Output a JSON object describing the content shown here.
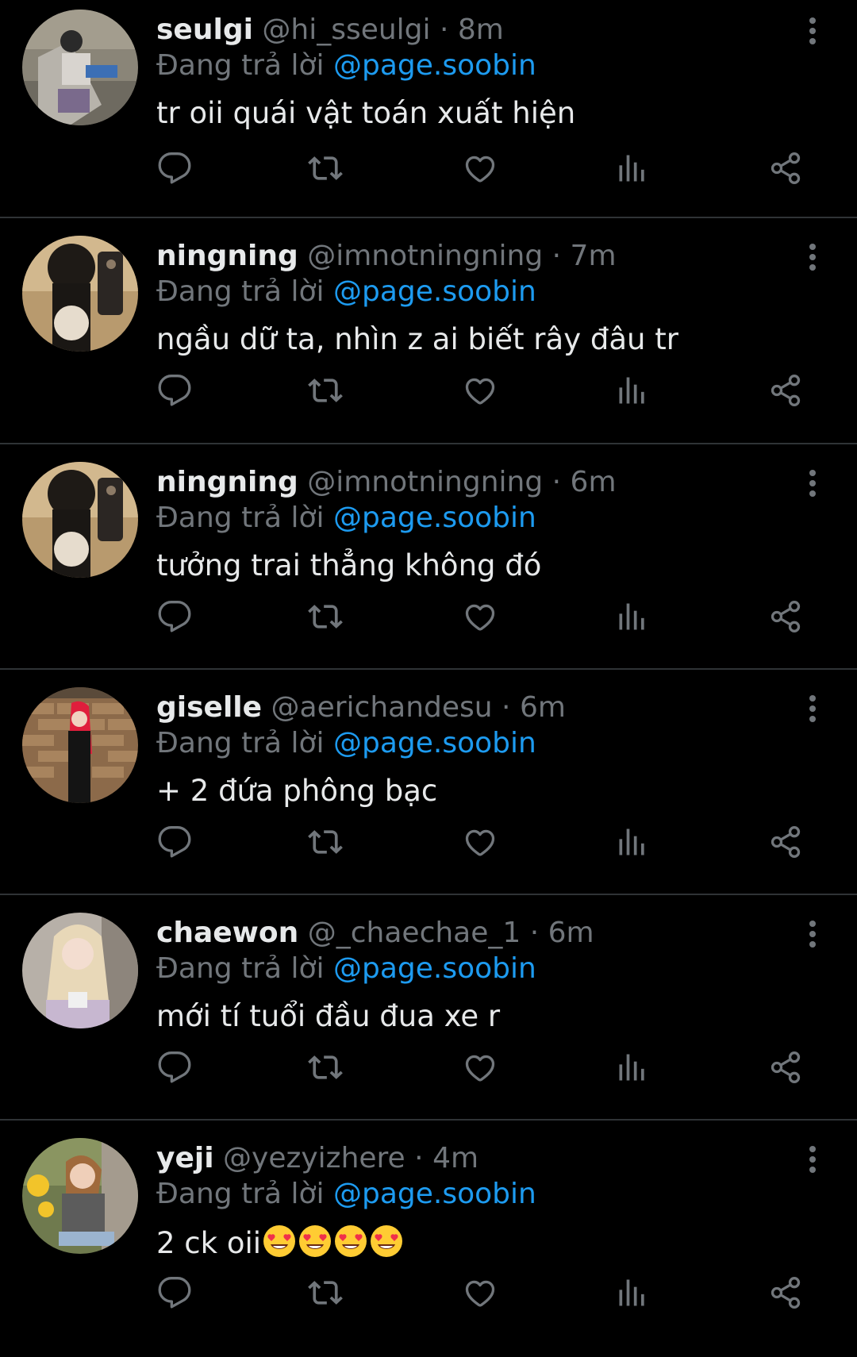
{
  "theme": {
    "background": "#000000",
    "text": "#e7e9ea",
    "muted": "#71767b",
    "accent": "#1d9bf0",
    "divider": "#2f3336"
  },
  "replies": [
    {
      "name": "seulgi",
      "handle": "@hi_sseulgi",
      "dot": "·",
      "time": "8m",
      "replying_prefix": "Đang trả lời",
      "replying_to": "@page.soobin",
      "text": "tr oii quái vật toán xuất hiện",
      "avatar_icon": "avatar-photo"
    },
    {
      "name": "ningning",
      "handle": "@imnotningning",
      "dot": "·",
      "time": "7m",
      "replying_prefix": "Đang trả lời",
      "replying_to": "@page.soobin",
      "text": "ngầu dữ ta, nhìn z ai biết rây đâu tr",
      "avatar_icon": "avatar-photo"
    },
    {
      "name": "ningning",
      "handle": "@imnotningning",
      "dot": "·",
      "time": "6m",
      "replying_prefix": "Đang trả lời",
      "replying_to": "@page.soobin",
      "text": "tưởng trai thẳng không đó",
      "avatar_icon": "avatar-photo"
    },
    {
      "name": "giselle",
      "handle": "@aerichandesu",
      "dot": "·",
      "time": "6m",
      "replying_prefix": "Đang trả lời",
      "replying_to": "@page.soobin",
      "text": "+ 2 đứa phông bạc",
      "avatar_icon": "avatar-photo"
    },
    {
      "name": "chaewon",
      "handle": "@_chaechae_1",
      "dot": "·",
      "time": "6m",
      "replying_prefix": "Đang trả lời",
      "replying_to": "@page.soobin",
      "text": "mới tí tuổi đầu đua xe r",
      "avatar_icon": "avatar-photo"
    },
    {
      "name": "yeji",
      "handle": "@yezyizhere",
      "dot": "·",
      "time": "4m",
      "replying_prefix": "Đang trả lời",
      "replying_to": "@page.soobin",
      "text": "2 ck oii",
      "emoji_icon": "heart-eyes-emoji",
      "emoji_count": 4,
      "avatar_icon": "avatar-photo"
    }
  ],
  "action_icons": [
    "reply-icon",
    "retweet-icon",
    "like-icon",
    "views-icon",
    "share-icon"
  ]
}
